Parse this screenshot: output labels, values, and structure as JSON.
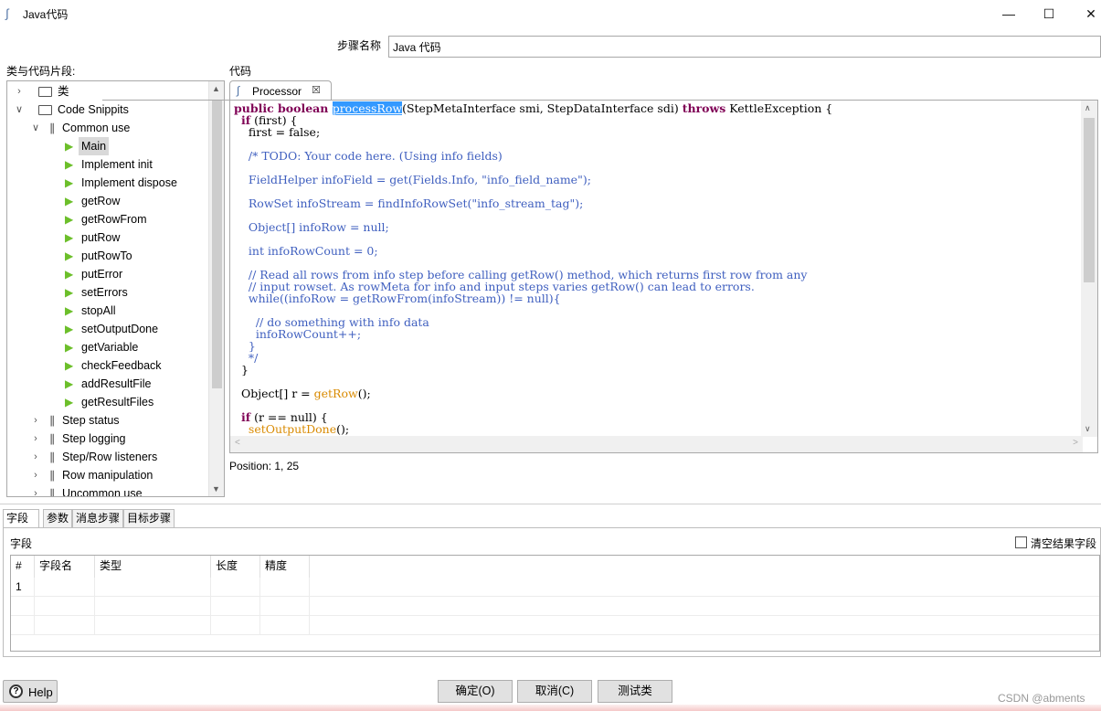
{
  "window": {
    "title": "Java代码",
    "icon": "java-script-icon",
    "controls": [
      "minimize",
      "maximize",
      "close"
    ]
  },
  "step": {
    "label": "步骤名称",
    "value": "Java 代码"
  },
  "tree": {
    "title": "类与代码片段:",
    "items": [
      {
        "label": "类",
        "expander": "collapsed",
        "icon": "folder-icon",
        "level": 0
      },
      {
        "label": "Code Snippits",
        "expander": "expanded",
        "icon": "folder-icon",
        "level": 0
      },
      {
        "label": "Common use",
        "expander": "expanded",
        "icon": "paperclip-icon",
        "level": 1
      },
      {
        "label": "Main",
        "icon": "play-icon",
        "level": 2,
        "selected": true
      },
      {
        "label": "Implement init",
        "icon": "play-icon",
        "level": 2
      },
      {
        "label": "Implement dispose",
        "icon": "play-icon",
        "level": 2
      },
      {
        "label": "getRow",
        "icon": "play-icon",
        "level": 2
      },
      {
        "label": "getRowFrom",
        "icon": "play-icon",
        "level": 2
      },
      {
        "label": "putRow",
        "icon": "play-icon",
        "level": 2
      },
      {
        "label": "putRowTo",
        "icon": "play-icon",
        "level": 2
      },
      {
        "label": "putError",
        "icon": "play-icon",
        "level": 2
      },
      {
        "label": "setErrors",
        "icon": "play-icon",
        "level": 2
      },
      {
        "label": "stopAll",
        "icon": "play-icon",
        "level": 2
      },
      {
        "label": "setOutputDone",
        "icon": "play-icon",
        "level": 2
      },
      {
        "label": "getVariable",
        "icon": "play-icon",
        "level": 2
      },
      {
        "label": "checkFeedback",
        "icon": "play-icon",
        "level": 2
      },
      {
        "label": "addResultFile",
        "icon": "play-icon",
        "level": 2
      },
      {
        "label": "getResultFiles",
        "icon": "play-icon",
        "level": 2
      },
      {
        "label": "Step status",
        "expander": "collapsed",
        "icon": "paperclip-icon",
        "level": 1
      },
      {
        "label": "Step logging",
        "expander": "collapsed",
        "icon": "paperclip-icon",
        "level": 1
      },
      {
        "label": "Step/Row listeners",
        "expander": "collapsed",
        "icon": "paperclip-icon",
        "level": 1
      },
      {
        "label": "Row manipulation",
        "expander": "collapsed",
        "icon": "paperclip-icon",
        "level": 1
      },
      {
        "label": "Uncommon use",
        "expander": "collapsed",
        "icon": "paperclip-icon",
        "level": 1
      }
    ]
  },
  "code_section": {
    "title": "代码",
    "tab_label": "Processor",
    "tab_icon": "java-script-icon",
    "lines": [
      [
        [
          "kw",
          "public boolean "
        ],
        [
          "hl",
          "processRow"
        ],
        [
          "",
          "(StepMetaInterface smi, StepDataInterface sdi) "
        ],
        [
          "kw",
          "throws"
        ],
        [
          "",
          " KettleException {"
        ]
      ],
      [
        [
          "",
          "  "
        ],
        [
          "kw",
          "if"
        ],
        [
          "",
          " (first) {"
        ]
      ],
      [
        [
          "",
          "    first = false;"
        ]
      ],
      [
        [
          "",
          ""
        ]
      ],
      [
        [
          "",
          "    "
        ],
        [
          "cm",
          "/* TODO: Your code here. (Using info fields)"
        ]
      ],
      [
        [
          "",
          ""
        ]
      ],
      [
        [
          "cm",
          "    FieldHelper infoField = get(Fields.Info, \"info_field_name\");"
        ]
      ],
      [
        [
          "",
          ""
        ]
      ],
      [
        [
          "cm",
          "    RowSet infoStream = findInfoRowSet(\"info_stream_tag\");"
        ]
      ],
      [
        [
          "",
          ""
        ]
      ],
      [
        [
          "cm",
          "    Object[] infoRow = null;"
        ]
      ],
      [
        [
          "",
          ""
        ]
      ],
      [
        [
          "cm",
          "    int infoRowCount = 0;"
        ]
      ],
      [
        [
          "",
          ""
        ]
      ],
      [
        [
          "cm",
          "    // Read all rows from info step before calling getRow() method, which returns first row from any"
        ]
      ],
      [
        [
          "cm",
          "    // input rowset. As rowMeta for info and input steps varies getRow() can lead to errors."
        ]
      ],
      [
        [
          "cm",
          "    while((infoRow = getRowFrom(infoStream)) != null){"
        ]
      ],
      [
        [
          "",
          ""
        ]
      ],
      [
        [
          "cm",
          "      // do something with info data"
        ]
      ],
      [
        [
          "cm",
          "      infoRowCount++;"
        ]
      ],
      [
        [
          "cm",
          "    }"
        ]
      ],
      [
        [
          "cm",
          "    */"
        ]
      ],
      [
        [
          "",
          "  }"
        ]
      ],
      [
        [
          "",
          ""
        ]
      ],
      [
        [
          "",
          "  Object[] r = "
        ],
        [
          "fn",
          "getRow"
        ],
        [
          "",
          "();"
        ]
      ],
      [
        [
          "",
          ""
        ]
      ],
      [
        [
          "",
          "  "
        ],
        [
          "kw",
          "if"
        ],
        [
          "",
          " (r == null) {"
        ]
      ],
      [
        [
          "",
          "    "
        ],
        [
          "fn",
          "setOutputDone"
        ],
        [
          "",
          "();"
        ]
      ]
    ],
    "position": "Position: 1, 25"
  },
  "bottom_tabs": [
    "字段",
    "参数",
    "消息步骤",
    "目标步骤"
  ],
  "fields": {
    "label": "字段",
    "clear_label": "清空结果字段",
    "clear_checked": false,
    "columns": [
      "#",
      "字段名",
      "类型",
      "长度",
      "精度"
    ],
    "rows": [
      [
        "1",
        "",
        "",
        "",
        ""
      ]
    ]
  },
  "buttons": {
    "help": "Help",
    "ok": "确定(O)",
    "cancel": "取消(C)",
    "test": "测试类"
  },
  "watermark": "CSDN @abments"
}
